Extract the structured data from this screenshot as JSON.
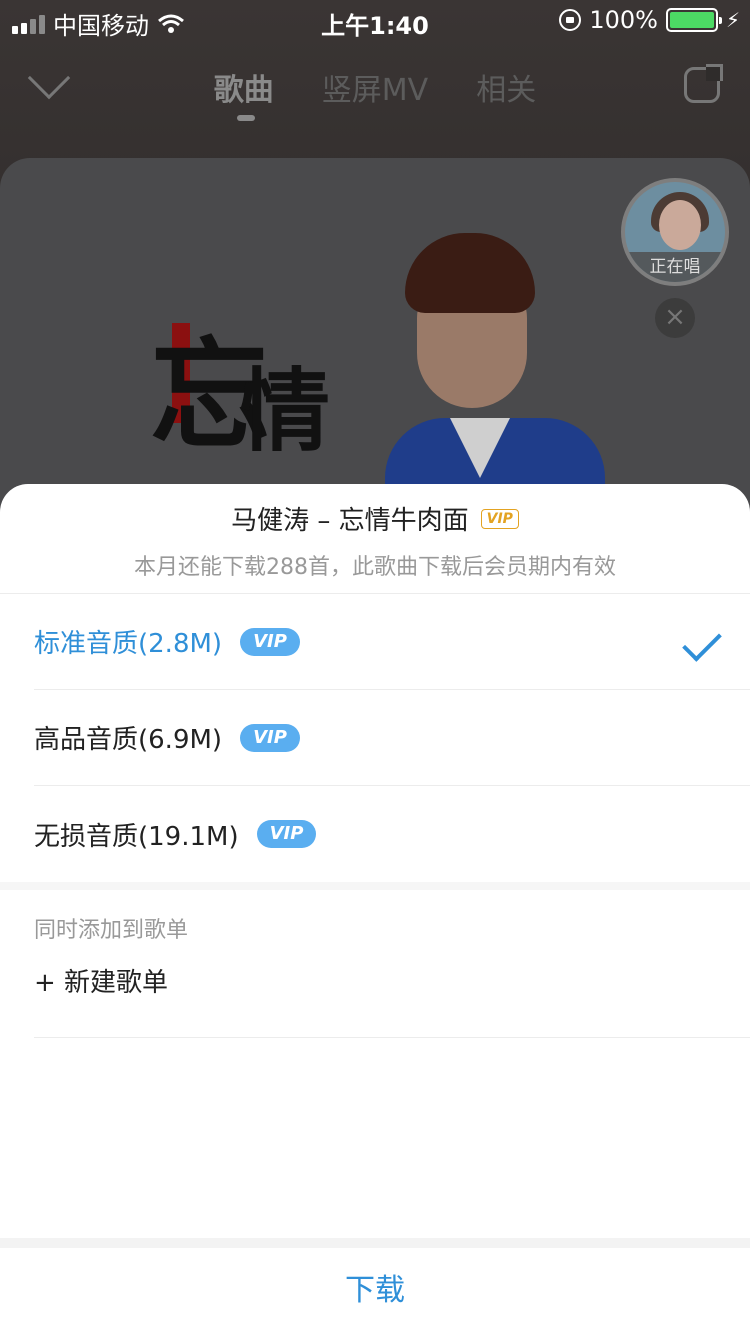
{
  "status_bar": {
    "carrier": "中国移动",
    "time": "上午1:40",
    "battery": "100%",
    "battery_level": 1.0
  },
  "player": {
    "tabs": [
      {
        "label": "歌曲",
        "active": true
      },
      {
        "label": "竖屏MV",
        "active": false
      },
      {
        "label": "相关",
        "active": false
      }
    ],
    "album_text": [
      "忘",
      "情"
    ],
    "now_singing_label": "正在唱"
  },
  "download_sheet": {
    "title": "马健涛 – 忘情牛肉面",
    "title_badge": "VIP",
    "subtitle": "本月还能下载288首，此歌曲下载后会员期内有效",
    "qualities": [
      {
        "label": "标准音质(2.8M)",
        "badge": "VIP",
        "selected": true
      },
      {
        "label": "高品音质(6.9M)",
        "badge": "VIP",
        "selected": false
      },
      {
        "label": "无损音质(19.1M)",
        "badge": "VIP",
        "selected": false
      }
    ],
    "playlist_caption": "同时添加到歌单",
    "new_playlist_label": "+ 新建歌单",
    "download_label": "下载"
  },
  "colors": {
    "accent_blue": "#2f8fd8",
    "vip_pill": "#5aaef0",
    "vip_gold": "#e3a322",
    "battery_green": "#4cd964"
  },
  "icons": {
    "back": "chevron-down-icon",
    "share": "share-icon",
    "close": "close-icon",
    "check": "check-icon",
    "wifi": "wifi-icon",
    "lock": "orientation-lock-icon"
  }
}
